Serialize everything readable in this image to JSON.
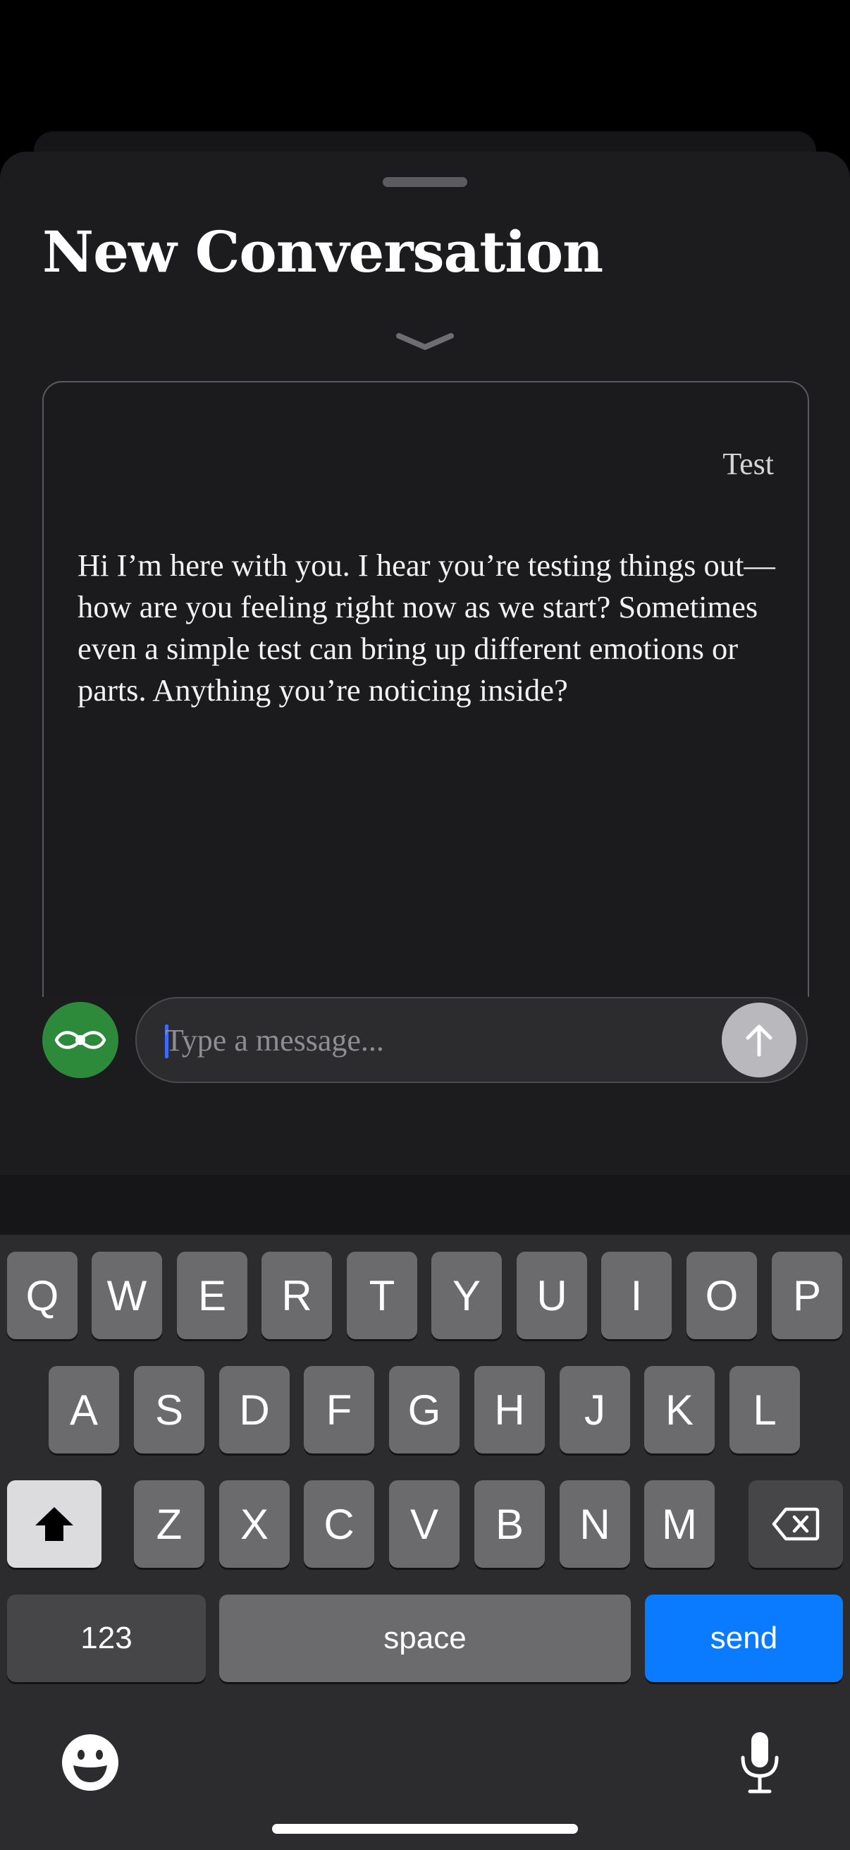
{
  "sheet": {
    "title": "New Conversation"
  },
  "conversation": {
    "user_message": "Test",
    "assistant_message": "Hi I’m here with you. I hear you’re testing things out—how are you feeling right now as we start? Sometimes even a simple test can bring up different emotions or parts. Anything you’re noticing inside?"
  },
  "composer": {
    "placeholder": "Type a message...",
    "value": ""
  },
  "keyboard": {
    "row1": [
      "Q",
      "W",
      "E",
      "R",
      "T",
      "Y",
      "U",
      "I",
      "O",
      "P"
    ],
    "row2": [
      "A",
      "S",
      "D",
      "F",
      "G",
      "H",
      "J",
      "K",
      "L"
    ],
    "row3": [
      "Z",
      "X",
      "C",
      "V",
      "B",
      "N",
      "M"
    ],
    "numbers_label": "123",
    "space_label": "space",
    "return_label": "send"
  },
  "colors": {
    "accent_green": "#2d8a3a",
    "return_key_blue": "#0a7bff"
  },
  "icons": {
    "logo": "infinity-eye-icon",
    "send": "arrow-up-icon",
    "shift": "shift-icon",
    "delete": "backspace-icon",
    "emoji": "emoji-icon",
    "dictation": "microphone-icon",
    "collapse": "chevron-down-icon"
  }
}
